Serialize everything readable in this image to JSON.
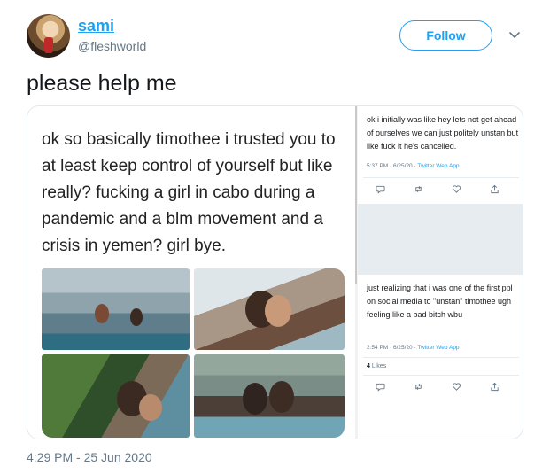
{
  "author": {
    "display_name": "sami",
    "handle": "@fleshworld"
  },
  "follow_label": "Follow",
  "tweet_text": "please help me",
  "media": {
    "quoted_text": "ok so basically timothee i trusted you to at least keep control of yourself but like really? fucking a girl in cabo during a pandemic and a blm movement and a crisis in yemen? girl bye.",
    "mini_tweets": [
      {
        "text": "ok i initially was like hey lets not get ahead of ourselves we can just politely unstan but like fuck it he's cancelled.",
        "time": "5:37 PM · 6/25/20 · ",
        "source": "Twitter Web App"
      },
      {
        "text": "just realizing that i was one of the first ppl on social media to \"unstan\" timothee ugh feeling like a bad bitch wbu",
        "time": "2:54 PM · 6/25/20 · ",
        "source": "Twitter Web App",
        "likes_count": "4",
        "likes_label": "Likes"
      }
    ],
    "icons": [
      "reply-icon",
      "retweet-icon",
      "like-icon",
      "share-icon"
    ]
  },
  "timestamp": "4:29 PM - 25 Jun 2020",
  "colors": {
    "accent": "#1da1f2",
    "muted": "#657786",
    "text": "#14171a"
  }
}
